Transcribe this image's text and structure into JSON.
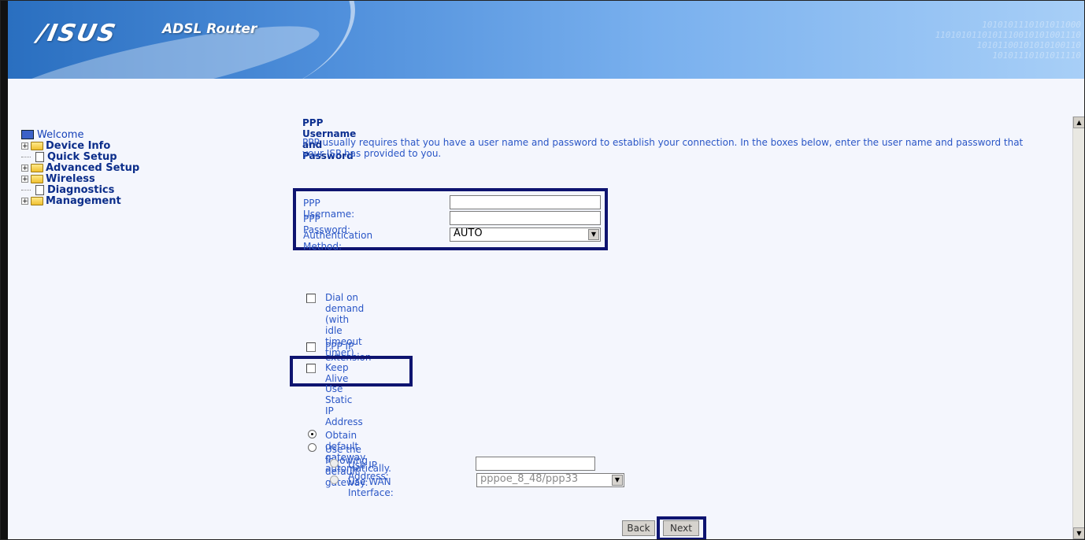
{
  "header": {
    "brand": "/ISUS",
    "product": "ADSL Router",
    "binary_lines": [
      "1010101110101011000",
      "1101010110101110010101001110",
      "10101100101010100110",
      "10101110101011110"
    ]
  },
  "nav": {
    "welcome": "Welcome",
    "items": [
      {
        "label": "Device Info",
        "kind": "folder"
      },
      {
        "label": "Quick Setup",
        "kind": "page"
      },
      {
        "label": "Advanced Setup",
        "kind": "folder"
      },
      {
        "label": "Wireless",
        "kind": "folder"
      },
      {
        "label": "Diagnostics",
        "kind": "page"
      },
      {
        "label": "Management",
        "kind": "folder"
      }
    ]
  },
  "form": {
    "title": "PPP Username and Password",
    "description": "PPP usually requires that you have a user name and password to establish your connection. In the boxes below, enter the user name and password that your ISP has provided to you.",
    "username_label": "PPP Username:",
    "username_value": "",
    "password_label": "PPP Password:",
    "password_value": "",
    "auth_label": "Authentication Method:",
    "auth_value": "AUTO",
    "dial_on_demand": "Dial on demand (with idle timeout timer)",
    "ppp_ip_extension": "PPP IP extension",
    "keep_alive": "Keep Alive",
    "static_ip": "Use Static IP Address",
    "gateway_auto": "Obtain default gateway automatically.",
    "gateway_manual": "Use the following default gateway:",
    "use_ip": "Use IP Address:",
    "use_ip_value": "",
    "use_wan": "Use WAN Interface:",
    "wan_value": "pppoe_8_48/ppp33",
    "back": "Back",
    "next": "Next"
  },
  "colors": {
    "highlight": "#0e1470",
    "label_text": "#2a56c6",
    "nav_text": "#0b2d8a"
  }
}
